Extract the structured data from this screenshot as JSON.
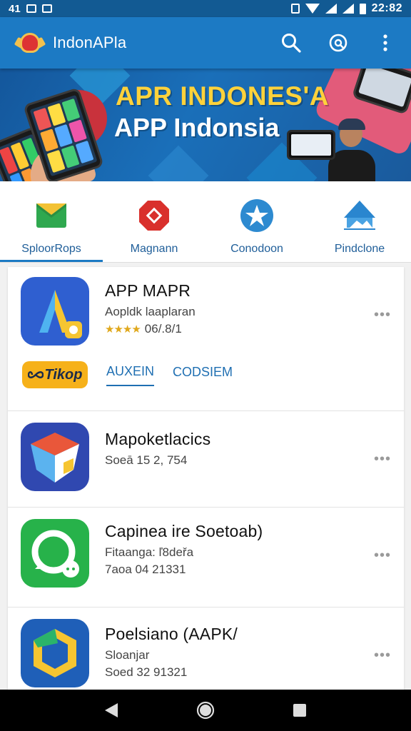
{
  "status_bar": {
    "left_text": "41",
    "time": "22:82"
  },
  "app_bar": {
    "title": "IndonAPla",
    "actions": [
      "search-icon",
      "explore-icon",
      "more-vert-icon"
    ]
  },
  "banner": {
    "line1": "APR INDONES'A",
    "line2": "APP Indonsia"
  },
  "categories": [
    {
      "label": "SploorRops",
      "icon": "mail-icon",
      "color": "#2fa84f",
      "active": true
    },
    {
      "label": "Magnann",
      "icon": "octagon-icon",
      "color": "#d9302c",
      "active": false
    },
    {
      "label": "Conodoon",
      "icon": "star-icon",
      "color": "#2d8ad0",
      "active": false
    },
    {
      "label": "Pindclone",
      "icon": "photo-icon",
      "color": "#2a86cf",
      "active": false
    }
  ],
  "apps": [
    {
      "title": "APP MAPR",
      "subtitle": "Aopldk laaplaran",
      "meta": "06/.8/1",
      "stars": "★★★★",
      "icon": "app-a-icon",
      "icon_color": "#2f5fd0",
      "actions": {
        "badge": "Tikop",
        "tab1": "AUXEIN",
        "tab2": "CODSIEM"
      }
    },
    {
      "title": "Mapoketlacics",
      "subtitle": "Soeā 15 2, 7̈54",
      "icon": "cube-icon",
      "icon_color": "#3048b0"
    },
    {
      "title": "Capinea ire Soetoab)",
      "subtitle": "Fitaanga: ľ8deřa",
      "meta": "7aoa 04 21331",
      "icon": "chat-icon",
      "icon_color": "#27b24a"
    },
    {
      "title": "Poelsiano (AAPK/",
      "subtitle": "Sloanjar",
      "meta": "Soed 32 91321",
      "icon": "hexagon-icon",
      "icon_color": "#1f5fb8"
    }
  ],
  "nav": [
    "back-icon",
    "home-icon",
    "recents-icon"
  ]
}
